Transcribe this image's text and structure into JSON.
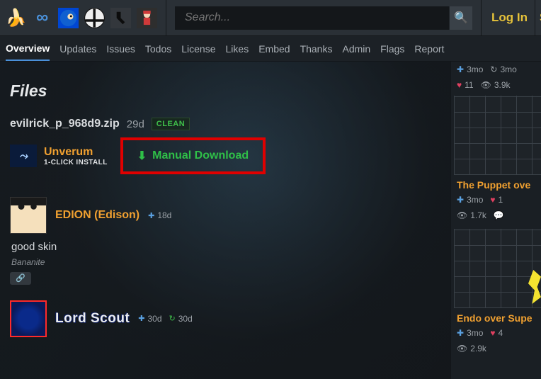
{
  "header": {
    "search_placeholder": "Search...",
    "login_label": "Log In",
    "login_right_label": "S",
    "icons": [
      "banana",
      "infinity",
      "sonic",
      "smash",
      "cs",
      "fnf"
    ]
  },
  "tabs": [
    "Overview",
    "Updates",
    "Issues",
    "Todos",
    "License",
    "Likes",
    "Embed",
    "Thanks",
    "Admin",
    "Flags",
    "Report"
  ],
  "files": {
    "section_title": "Files",
    "name": "evilrick_p_968d9.zip",
    "age": "29d",
    "scan_badge": "CLEAN",
    "installer": {
      "title": "Unverum",
      "subtitle": "1-CLICK INSTALL"
    },
    "manual_label": "Manual Download"
  },
  "comments": [
    {
      "user": "EDION (Edison)",
      "age": "18d",
      "body": "good skin",
      "role": "Bananite"
    },
    {
      "user": "Lord Scout",
      "age": "30d",
      "age2": "30d"
    }
  ],
  "sidebar": {
    "top_stats": {
      "added": "3mo",
      "updated": "3mo",
      "likes": "11",
      "views": "3.9k"
    },
    "items": [
      {
        "title": "The Puppet ove",
        "added": "3mo",
        "likes": "1",
        "views": "1.7k"
      },
      {
        "title": "Endo over Supe",
        "added": "3mo",
        "likes": "4",
        "views": "2.9k"
      }
    ]
  }
}
